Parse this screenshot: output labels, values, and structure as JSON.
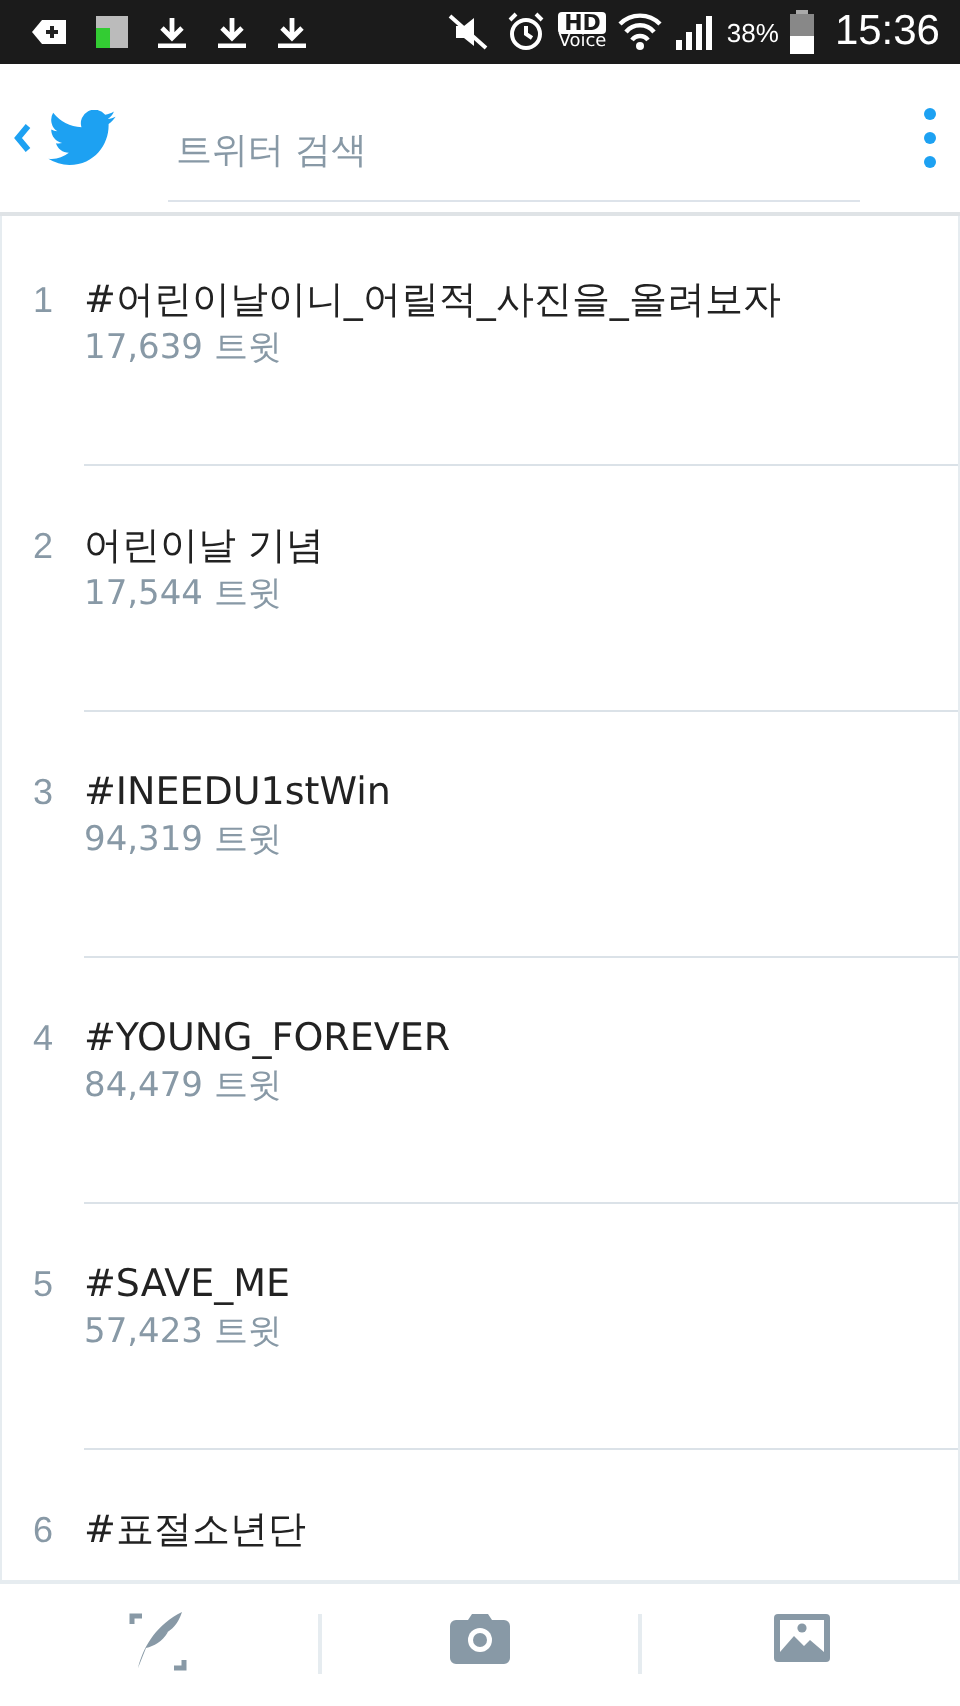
{
  "status_bar": {
    "hd_label": "HD",
    "voice_label": "Voice",
    "battery": "38%",
    "time": "15:36"
  },
  "header": {
    "search": {
      "placeholder": "트위터 검색"
    }
  },
  "trends": [
    {
      "rank": "1",
      "name": "#어린이날이니_어릴적_사진을_올려보자",
      "count": "17,639 트윗"
    },
    {
      "rank": "2",
      "name": "어린이날 기념",
      "count": "17,544 트윗"
    },
    {
      "rank": "3",
      "name": "#INEEDU1stWin",
      "count": "94,319 트윗"
    },
    {
      "rank": "4",
      "name": "#YOUNG_FOREVER",
      "count": "84,479 트윗"
    },
    {
      "rank": "5",
      "name": "#SAVE_ME",
      "count": "57,423 트윗"
    },
    {
      "rank": "6",
      "name": "#표절소년단"
    }
  ]
}
